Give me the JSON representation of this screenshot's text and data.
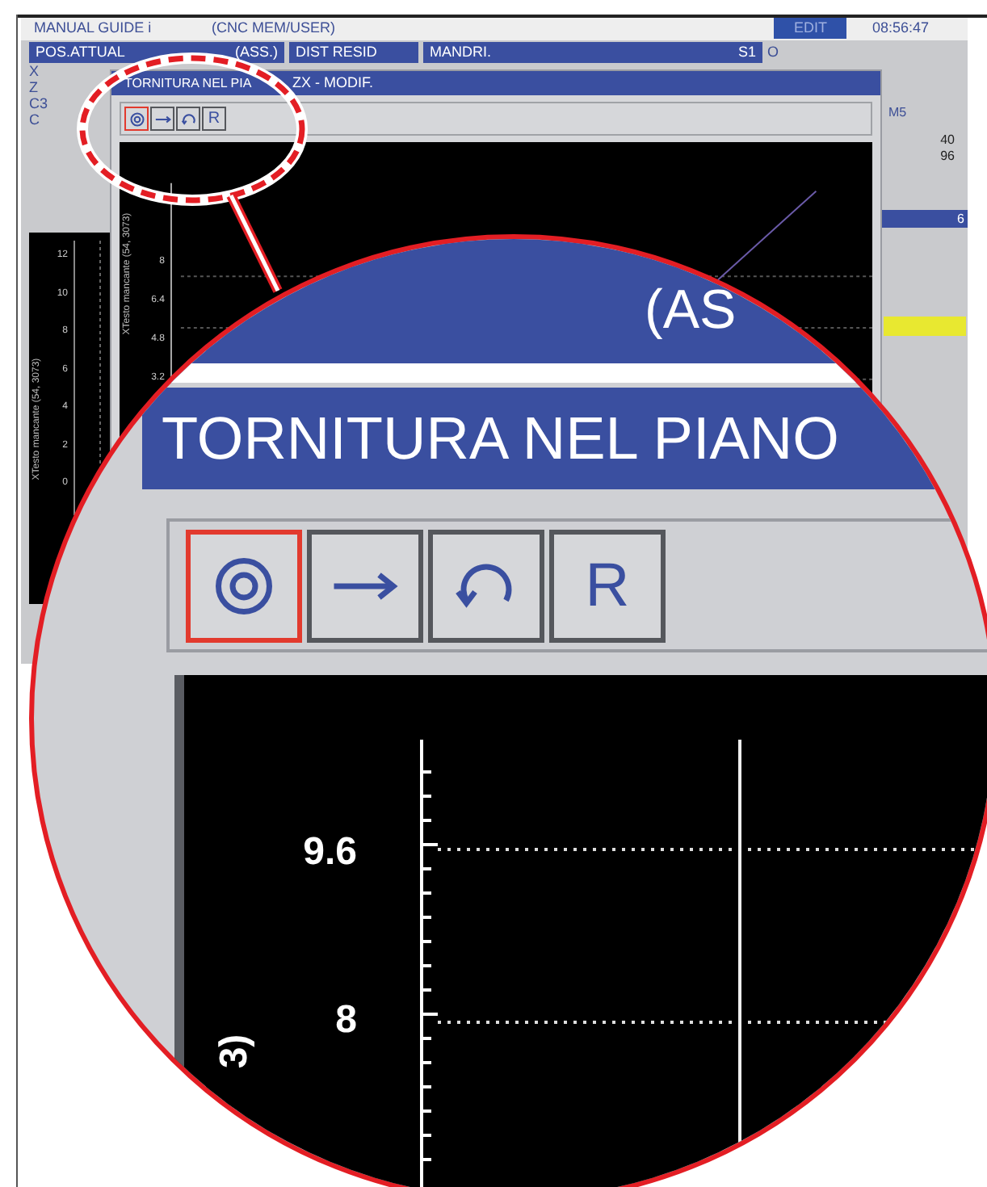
{
  "header": {
    "title": "MANUAL GUIDE i",
    "mode": "(CNC MEM/USER)",
    "status": "EDIT",
    "time": "08:56:47"
  },
  "position_header": {
    "label": "POS.ATTUAL",
    "unit": "(ASS.)"
  },
  "distance_header": "DIST RESID",
  "spindle_header": {
    "label": "MANDRI.",
    "value": "S1"
  },
  "program_label": "O",
  "axes": [
    "X",
    "Z",
    "C3",
    "C"
  ],
  "dialog": {
    "title_parts": [
      "TORNITURA NEL PIA",
      "ZX - MODIF."
    ],
    "toolbar": [
      {
        "kind": "icon",
        "selected": true
      },
      {
        "kind": "icon",
        "selected": false
      },
      {
        "kind": "icon",
        "selected": false
      },
      {
        "kind": "text",
        "label": "R",
        "selected": false
      }
    ],
    "chart": {
      "y_label": "XTesto mancante (54, 3073)",
      "y_ticks": [
        "8",
        "6.4",
        "4.8",
        "3.2"
      ]
    }
  },
  "side_plot": {
    "y_label": "XTesto mancante (54, 3073)",
    "y_ticks": [
      "12",
      "10",
      "8",
      "6",
      "4",
      "2",
      "0"
    ]
  },
  "right_panel": {
    "m_code": "M5",
    "values": [
      "40",
      "96"
    ],
    "bar_value": "6"
  },
  "magnifier": {
    "header_fragment": "(AS",
    "title": "TORNITURA NEL PIANO",
    "toolbar": [
      {
        "kind": "icon",
        "selected": true
      },
      {
        "kind": "icon",
        "selected": false
      },
      {
        "kind": "icon",
        "selected": false
      },
      {
        "kind": "text",
        "label": "R",
        "selected": false
      }
    ],
    "y_ticks": [
      "9.6",
      "8"
    ],
    "y_label_fragment": "3)"
  }
}
